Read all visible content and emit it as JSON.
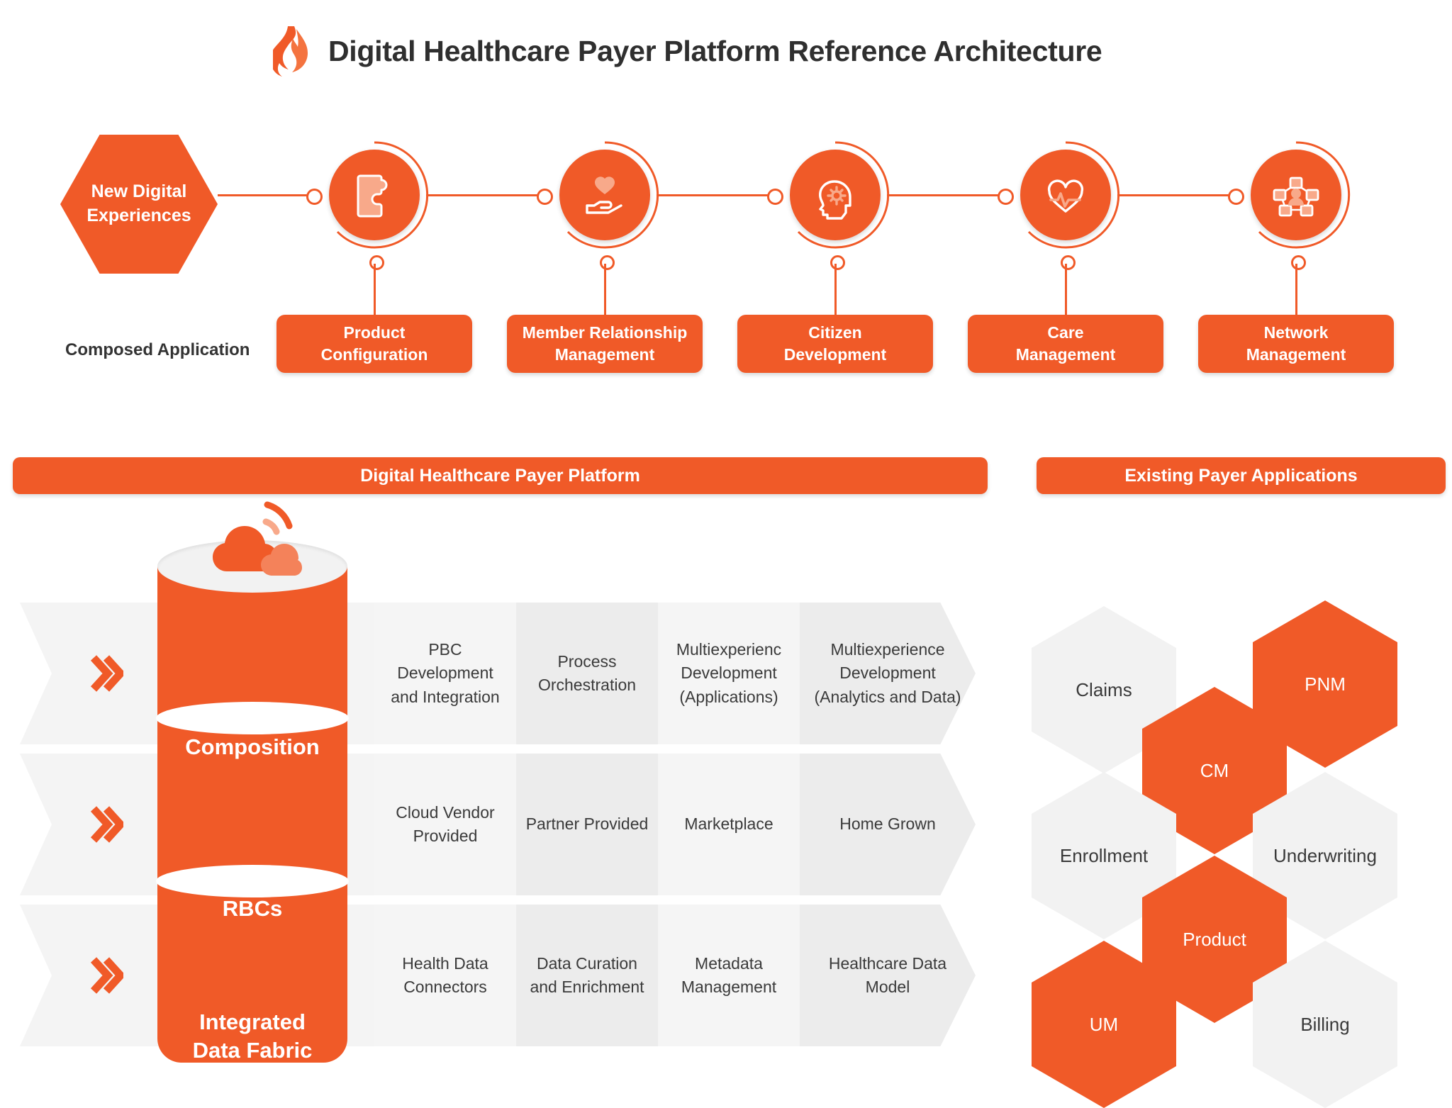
{
  "header": {
    "logo_icon": "flame-icon",
    "title": "Digital Healthcare Payer Platform Reference Architecture"
  },
  "top_flow": {
    "entry_hex": {
      "line1": "New Digital",
      "line2": "Experiences"
    },
    "composed_label": "Composed Application",
    "nodes": [
      {
        "icon": "puzzle-piece-icon",
        "app_line1": "Product",
        "app_line2": "Configuration"
      },
      {
        "icon": "heart-in-hand-icon",
        "app_line1": "Member Relationship",
        "app_line2": "Management"
      },
      {
        "icon": "head-gear-icon",
        "app_line1": "Citizen",
        "app_line2": "Development"
      },
      {
        "icon": "heart-pulse-icon",
        "app_line1": "Care",
        "app_line2": "Management"
      },
      {
        "icon": "network-person-icon",
        "app_line1": "Network",
        "app_line2": "Management"
      }
    ]
  },
  "platform": {
    "bar_label": "Digital Healthcare Payer Platform",
    "cylinder_icon": "cloud-wifi-icon",
    "layers": [
      {
        "name_line1": "Composition",
        "name_line2": "",
        "chevron_icon": "double-chevron-right-icon",
        "cells": [
          "PBC Development and Integration",
          "Process Orchestration",
          "Multiexperienc Development (Applications)",
          "Multiexperience Development (Analytics and Data)"
        ]
      },
      {
        "name_line1": "RBCs",
        "name_line2": "",
        "chevron_icon": "double-chevron-right-icon",
        "cells": [
          "Cloud Vendor Provided",
          "Partner Provided",
          "Marketplace",
          "Home Grown"
        ]
      },
      {
        "name_line1": "Integrated",
        "name_line2": "Data Fabric",
        "chevron_icon": "double-chevron-right-icon",
        "cells": [
          "Health Data Connectors",
          "Data Curation and Enrichment",
          "Metadata Management",
          "Healthcare Data Model"
        ]
      }
    ]
  },
  "existing": {
    "bar_label": "Existing Payer Applications",
    "hexes": [
      {
        "label": "Claims",
        "style": "gray"
      },
      {
        "label": "PNM",
        "style": "orange"
      },
      {
        "label": "CM",
        "style": "orange"
      },
      {
        "label": "Enrollment",
        "style": "gray"
      },
      {
        "label": "Underwriting",
        "style": "gray"
      },
      {
        "label": "Product",
        "style": "orange"
      },
      {
        "label": "UM",
        "style": "orange"
      },
      {
        "label": "Billing",
        "style": "gray"
      }
    ]
  },
  "colors": {
    "brand_orange": "#f05a28",
    "icon_light": "#f8a98a",
    "cell_light": "#f5f5f5",
    "cell_dark": "#ececec",
    "text_dark": "#3a3a3a"
  }
}
